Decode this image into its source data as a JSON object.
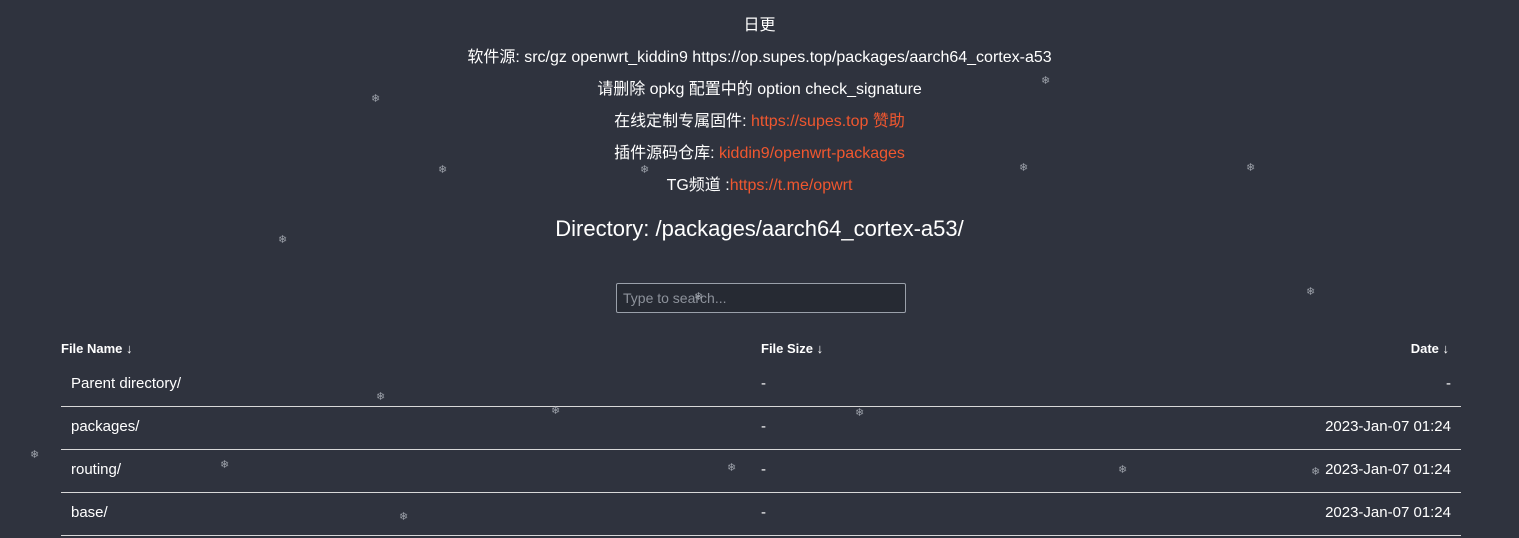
{
  "header": {
    "update": "日更",
    "source_line": "软件源: src/gz openwrt_kiddin9 https://op.supes.top/packages/aarch64_cortex-a53",
    "signature_note": "请删除 opkg 配置中的 option check_signature",
    "custom_firmware_label": "在线定制专属固件: ",
    "custom_firmware_link": "https://supes.top",
    "sponsor_link": "赞助",
    "repo_label": "插件源码仓库: ",
    "repo_link": "kiddin9/openwrt-packages",
    "tg_label": "TG频道 :",
    "tg_link": "https://t.me/opwrt"
  },
  "directory_title": "Directory: /packages/aarch64_cortex-a53/",
  "search": {
    "placeholder": "Type to search..."
  },
  "table": {
    "columns": {
      "name": "File Name ↓",
      "size": "File Size ↓",
      "date": "Date ↓"
    },
    "rows": [
      {
        "name": "Parent directory/",
        "size": "-",
        "date": "-"
      },
      {
        "name": "packages/",
        "size": "-",
        "date": "2023-Jan-07 01:24"
      },
      {
        "name": "routing/",
        "size": "-",
        "date": "2023-Jan-07 01:24"
      },
      {
        "name": "base/",
        "size": "-",
        "date": "2023-Jan-07 01:24"
      }
    ]
  },
  "decoration": {
    "snowflake_icon": "snowflake-icon",
    "snowflake_glyph": "❄"
  },
  "colors": {
    "background": "#2f333e",
    "link": "#f0572f",
    "text": "#ffffff"
  }
}
